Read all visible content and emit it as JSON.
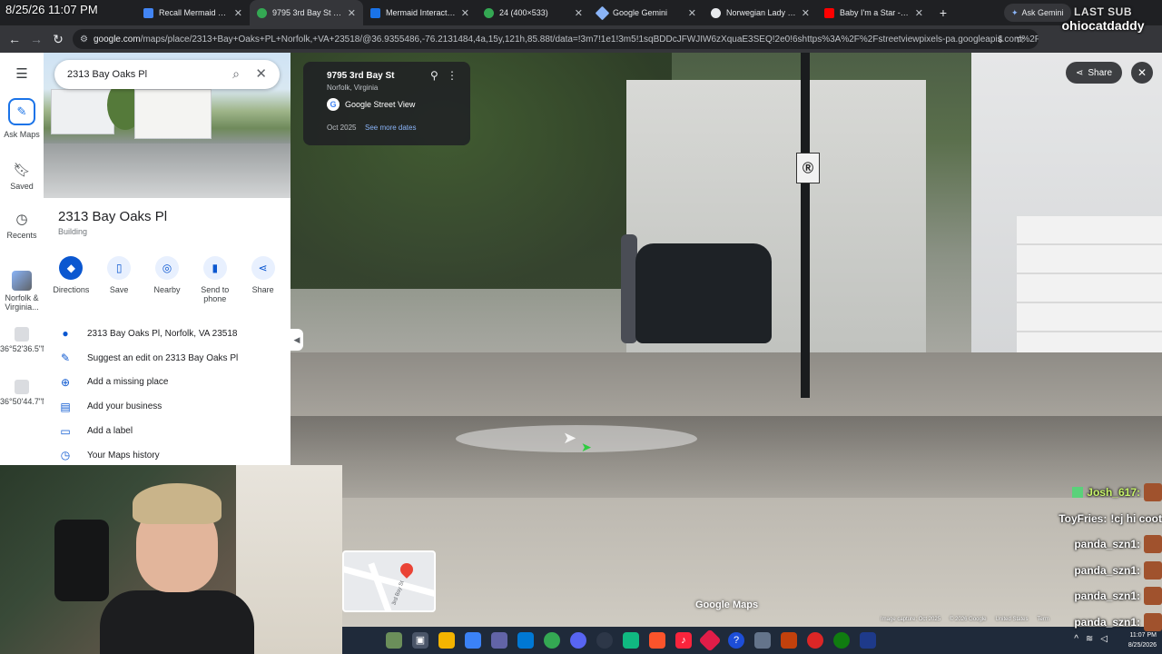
{
  "overlay": {
    "timestamp": "8/25/26 11:07 PM",
    "last_sub_label": "LAST SUB",
    "last_sub_name": "ohiocatdaddy"
  },
  "tabs": [
    {
      "title": "Recall Mermaid Statue",
      "color": "#4285f4",
      "active": false
    },
    {
      "title": "9795 3rd Bay St - Goo",
      "color": "#34a853",
      "active": true
    },
    {
      "title": "Mermaid Interactive S",
      "color": "#1a73e8",
      "active": false
    },
    {
      "title": "24 (400×533)",
      "color": "#34a853",
      "active": false
    },
    {
      "title": "Google Gemini",
      "color": "#8ab4f8",
      "active": false
    },
    {
      "title": "Norwegian Lady Statu",
      "color": "#e8eaed",
      "active": false
    },
    {
      "title": "Baby I'm a Star - YouT",
      "color": "#ff0000",
      "active": false
    }
  ],
  "browser": {
    "ask_gemini": "Ask Gemini",
    "url_host": "google.com",
    "url_rest": "/maps/place/2313+Bay+Oaks+PL+Norfolk,+VA+23518/@36.9355486,-76.2131484,4a,15y,121h,85.88t/data=!3m7!1e1!3m5!1sqBDDcJFWJIW6zXquaE3SEQ!2e0!6shttps%3A%2F%2Fstreetviewpixels-pa.googleapis.com%2Fv1%2Fthu..."
  },
  "rail": {
    "ask_maps": "Ask Maps",
    "saved": "Saved",
    "recents": "Recents",
    "recent1": "Norfolk & Virginia...",
    "recent2": "36°52'36.5\"N...",
    "recent3": "36°50'44.7\"N..."
  },
  "search": {
    "value": "2313 Bay Oaks Pl"
  },
  "place": {
    "title": "2313 Bay Oaks Pl",
    "subtitle": "Building",
    "actions": [
      "Directions",
      "Save",
      "Nearby",
      "Send to phone",
      "Share"
    ],
    "info": [
      "2313 Bay Oaks Pl, Norfolk, VA 23518",
      "Suggest an edit on 2313 Bay Oaks Pl",
      "Add a missing place",
      "Add your business",
      "Add a label",
      "Your Maps history"
    ]
  },
  "streetview": {
    "address": "9795 3rd Bay St",
    "city": "Norfolk, Virginia",
    "provider": "Google Street View",
    "date": "Oct 2025",
    "more_dates": "See more dates",
    "share": "Share",
    "watermark": "Google Maps",
    "minimap_label": "3rd Bay St",
    "attribution": [
      "Image capture: Oct 2025",
      "© 2026 Google",
      "United States",
      "Term"
    ]
  },
  "chat": [
    {
      "name": "Josh_617:",
      "message": "",
      "highlight": true
    },
    {
      "name": "ToyFries:",
      "message": "!cj hi coot",
      "highlight": false
    },
    {
      "name": "panda_szn1:",
      "message": "",
      "highlight": false
    },
    {
      "name": "panda_szn1:",
      "message": "",
      "highlight": false
    },
    {
      "name": "panda_szn1:",
      "message": "",
      "highlight": false
    },
    {
      "name": "panda_szn1:",
      "message": "",
      "highlight": false
    }
  ],
  "taskbar": {
    "time": "11:07 PM",
    "date": "8/25/2026"
  }
}
